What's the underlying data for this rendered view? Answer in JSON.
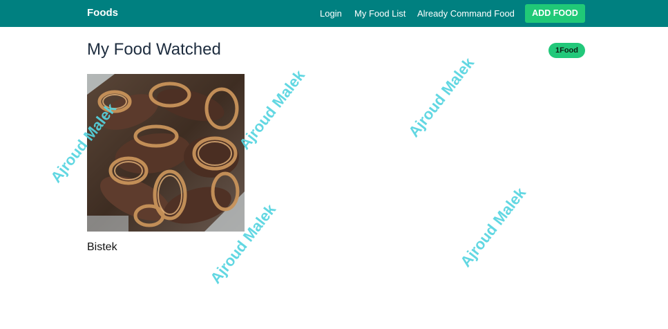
{
  "navbar": {
    "brand": "Foods",
    "links": [
      "Login",
      "My Food List",
      "Already Command Food"
    ],
    "add_button": "ADD FOOD",
    "background": "#008080",
    "accent": "#20c977"
  },
  "header": {
    "title": "My Food Watched",
    "badge": "1Food"
  },
  "foods": [
    {
      "name": "Bistek"
    }
  ],
  "watermark": {
    "text": "Ajroud Malek",
    "color": "#55d4e0"
  }
}
